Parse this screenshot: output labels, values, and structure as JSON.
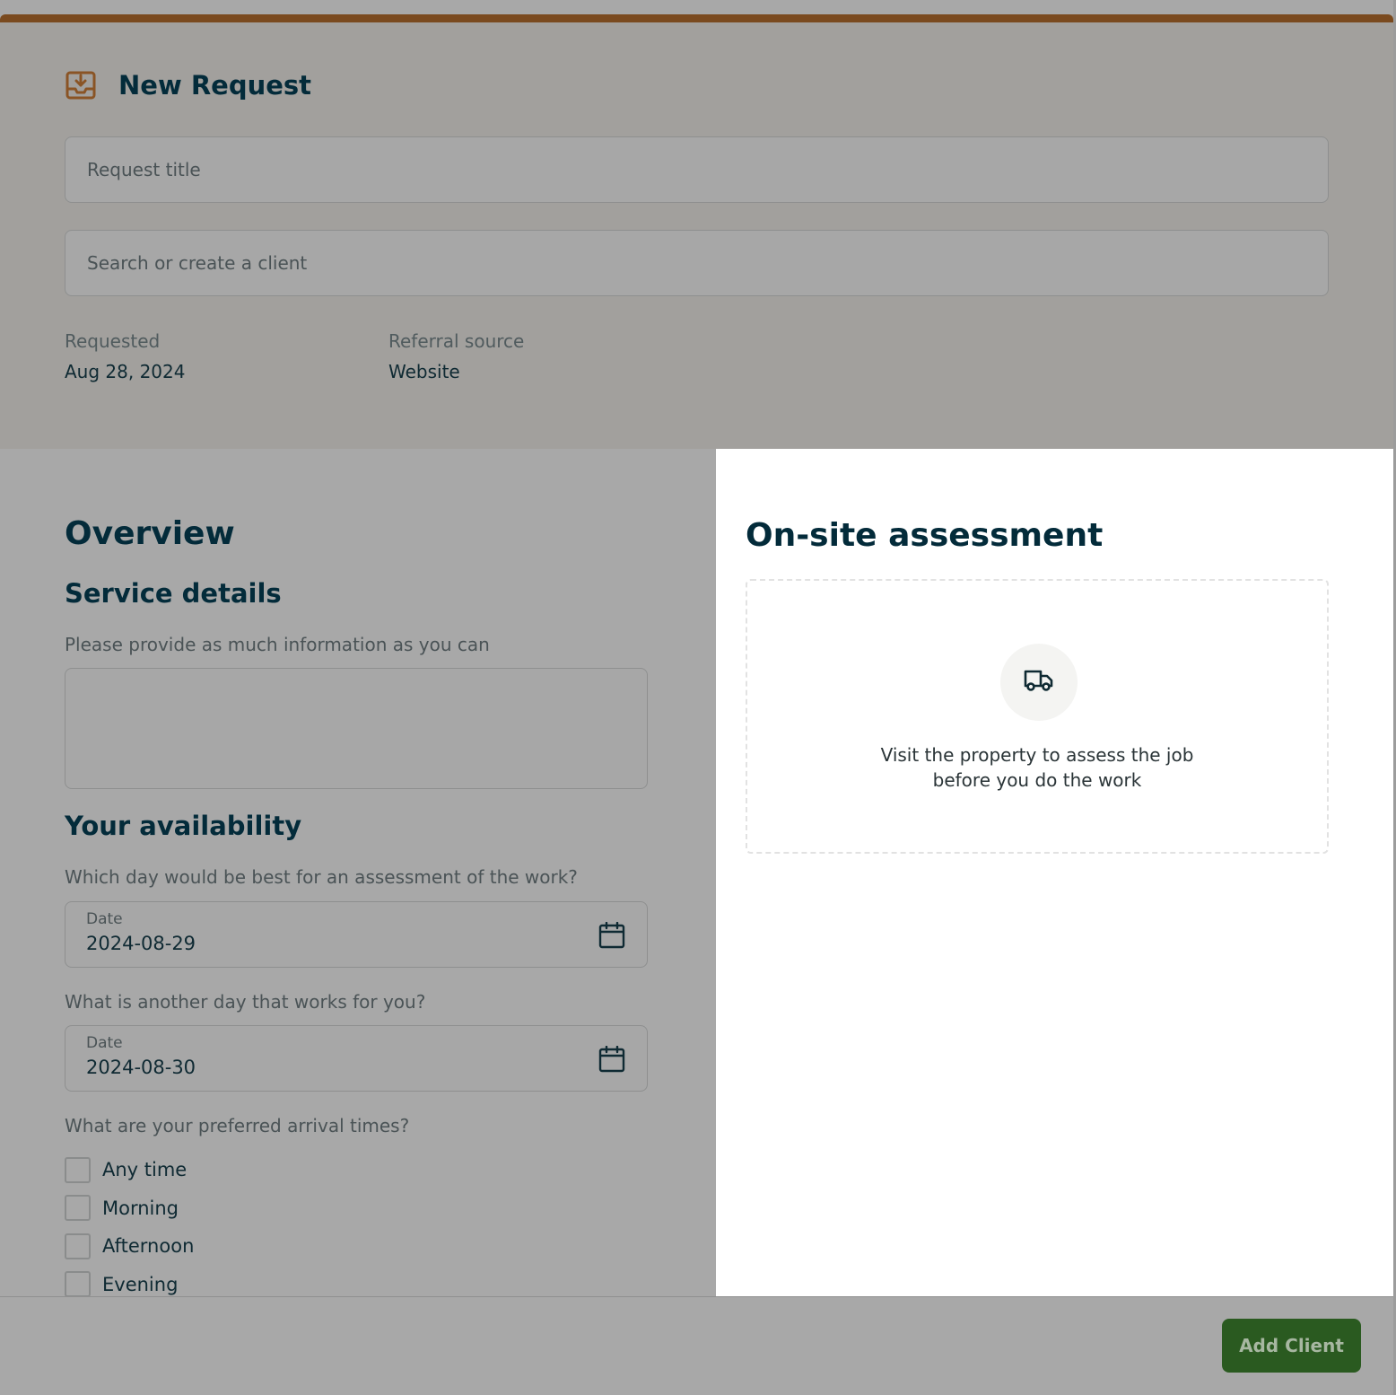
{
  "colors": {
    "accent_bar": "#7a4a1f",
    "icon_accent": "#8a5425",
    "primary_button": "#2a5a20"
  },
  "header": {
    "icon": "inbox-download-icon",
    "title": "New Request",
    "request_title_placeholder": "Request title",
    "client_placeholder": "Search or create a client",
    "requested_label": "Requested",
    "requested_value": "Aug 28, 2024",
    "referral_label": "Referral source",
    "referral_value": "Website"
  },
  "overview": {
    "heading": "Overview",
    "service_heading": "Service details",
    "service_hint": "Please provide as much information as you can",
    "service_value": ""
  },
  "availability": {
    "heading": "Your availability",
    "day1_question": "Which day would be best for an assessment of the work?",
    "day1_label": "Date",
    "day1_value": "2024-08-29",
    "day2_question": "What is another day that works for you?",
    "day2_label": "Date",
    "day2_value": "2024-08-30",
    "arrival_question": "What are your preferred arrival times?",
    "arrival_options": [
      {
        "label": "Any time",
        "checked": false
      },
      {
        "label": "Morning",
        "checked": false
      },
      {
        "label": "Afternoon",
        "checked": false
      },
      {
        "label": "Evening",
        "checked": false
      }
    ]
  },
  "assessment": {
    "heading": "On-site assessment",
    "icon": "truck-icon",
    "description_line1": "Visit the property to assess the job",
    "description_line2": "before you do the work"
  },
  "footer": {
    "add_client_label": "Add Client"
  }
}
